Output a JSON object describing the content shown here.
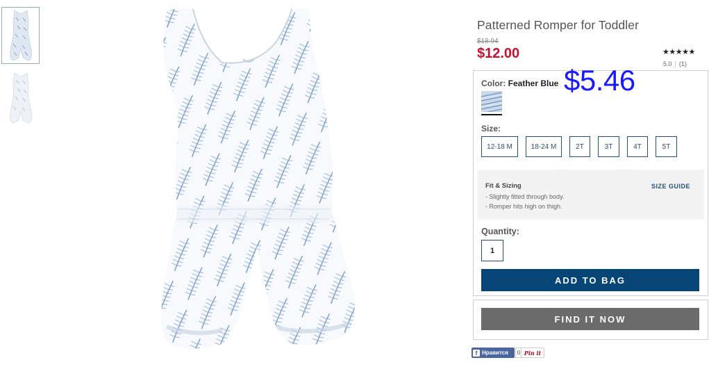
{
  "product": {
    "title": "Patterned Romper for Toddler",
    "old_price": "$18.94",
    "sale_price": "$12.00",
    "stars": "★★★★★",
    "rating_value": "5.0",
    "rating_count": "(1)",
    "overlay_price": "$5.46"
  },
  "color": {
    "label": "Color:",
    "name": "Feather Blue"
  },
  "size": {
    "label": "Size:",
    "options": [
      "12-18 M",
      "18-24 M",
      "2T",
      "3T",
      "4T",
      "5T"
    ]
  },
  "fit": {
    "title": "Fit & Sizing",
    "lines": [
      "- Slightly fitted through body.",
      "- Romper hits high on thigh."
    ],
    "size_guide": "SIZE GUIDE"
  },
  "quantity": {
    "label": "Quantity:",
    "value": "1"
  },
  "buttons": {
    "add_to_bag": "ADD TO BAG",
    "find_it_now": "FIND IT NOW"
  },
  "social": {
    "fb_label": "Нравится",
    "fb_count": "0",
    "pin_label": "Pin it"
  },
  "colors": {
    "sale_red": "#c8102e",
    "navy": "#084577",
    "grey_button": "#6b6b6b",
    "overlay_blue": "#1a1aff"
  }
}
